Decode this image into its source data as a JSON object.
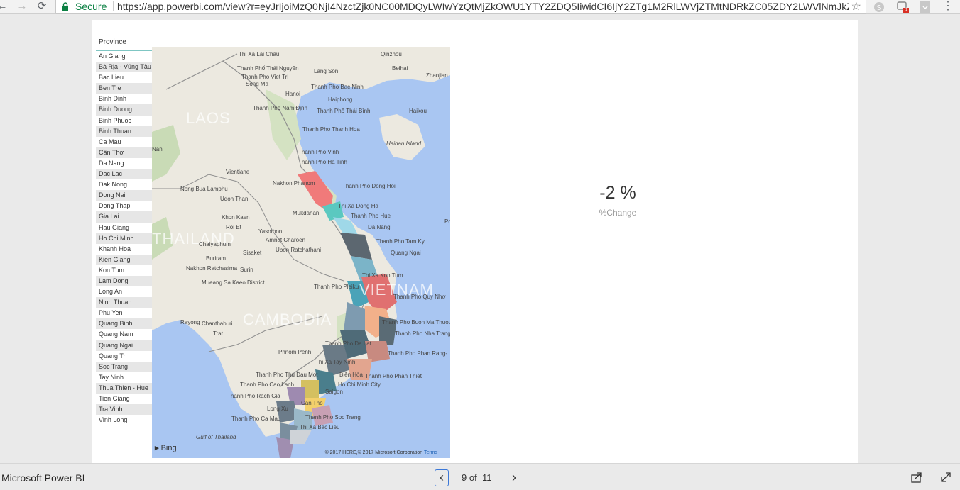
{
  "browser": {
    "secure_label": "Secure",
    "url": "https://app.powerbi.com/view?r=eyJrIjoiMzQ0NjI4NzctZjk0NC00MDQyLWIwYzQtMjZkOWU1YTY2ZDQ5IiwidCI6IjY2ZTg1M2RlLWVjZTMtNDRkZC05ZDY2LWVlNmJkZjQ",
    "back_glyph": "←",
    "forward_glyph": "→",
    "reload_glyph": "⟳",
    "star_glyph": "☆",
    "menu_glyph": "⋮",
    "ext_badge": "1",
    "icons": [
      "back-icon",
      "forward-icon",
      "reload-icon",
      "lock-icon",
      "star-icon",
      "skype-icon",
      "extension-icon",
      "bookmark-icon",
      "menu-icon"
    ]
  },
  "report": {
    "slicer": {
      "title": "Province",
      "items": [
        "An Giang",
        "Bà Rịa - Vũng Tàu",
        "Bac Lieu",
        "Ben Tre",
        "Binh Dinh",
        "Binh Duong",
        "Binh Phuoc",
        "Binh Thuan",
        "Ca Mau",
        "Cần Thơ",
        "Da Nang",
        "Dac Lac",
        "Dak Nong",
        "Dong Nai",
        "Dong Thap",
        "Gia Lai",
        "Hau Giang",
        "Ho Chi Minh",
        "Khanh Hoa",
        "Kien Giang",
        "Kon Tum",
        "Lam Dong",
        "Long An",
        "Ninh Thuan",
        "Phu Yen",
        "Quang Binh",
        "Quang Nam",
        "Quang Ngai",
        "Quang Tri",
        "Soc Trang",
        "Tay Ninh",
        "Thua Thien - Hue",
        "Tien Giang",
        "Tra Vinh",
        "Vinh Long"
      ]
    },
    "map": {
      "countries": [
        "LAOS",
        "THAILAND",
        "CAMBODIA",
        "VIETNAM"
      ],
      "labels": [
        "Thi Xã Lai Châu",
        "Qinzhou",
        "Thanh Phố Thái Nguyên",
        "Beihai",
        "Zhanjian",
        "Lang Son",
        "Thanh Pho Viet Tri",
        "Sông Mã",
        "Hanoi",
        "Thanh Pho Bac Ninh",
        "Haiphong",
        "Thanh Phố Nam Định",
        "Thanh Phố Thái Bình",
        "Haikou",
        "Thanh Pho Thanh Hoa",
        "Hainan Island",
        "Nan",
        "Thanh Pho Vinh",
        "Thanh Pho Ha Tinh",
        "Vientiane",
        "Nakhon Phanom",
        "Nong Bua Lamphu",
        "Udon Thani",
        "Thanh Pho Dong Hoi",
        "Thi Xa Dong Ha",
        "Mukdahan",
        "Thanh Pho Hue",
        "Khon Kaen",
        "Roi Et",
        "Da Nang",
        "Yasothon",
        "Amnat Charoen",
        "Thanh Pho Tam Ky",
        "Chaiyaphum",
        "Ubon Ratchathani",
        "Quang Ngai",
        "Buriram",
        "Sisaket",
        "Nakhon Ratchasima",
        "Surin",
        "Thi Xa Kon Tum",
        "Thanh Pho Pleiku",
        "Mueang Sa Kaeo District",
        "Thanh Pho Quy Nhơ",
        "Rayong",
        "Chanthaburi",
        "Trat",
        "Thanh Pho Buon Ma Thuot",
        "Thanh Pho Nha Trang",
        "Thanh Pho Da Lat",
        "Phnom Penh",
        "Thanh Pho Phan Rang-",
        "Thi Xa Tay Ninh",
        "Thanh Pho Thu Dau Mot",
        "Biên Hòa",
        "Thanh Pho Phan Thiet",
        "Thanh Pho Cao Lanh",
        "Ho Chi Minh City",
        "Saigon",
        "Thanh Pho Rach Gia",
        "Can Tho",
        "Long Xu",
        "Thanh Pho Soc Trang",
        "Thanh Pho Ca Mau",
        "Thi Xa Bac Lieu",
        "Gulf of Thailand",
        "Po"
      ],
      "attribution_logo": "Bing",
      "copyright": "© 2017 HERE,© 2017 Microsoft Corporation",
      "terms": "Terms"
    },
    "card": {
      "value": "-2 %",
      "label": "%Change"
    }
  },
  "footer": {
    "brand": "Microsoft Power BI",
    "prev_glyph": "‹",
    "next_glyph": "›",
    "page_current": "9",
    "page_of": "of",
    "page_total": "11"
  }
}
